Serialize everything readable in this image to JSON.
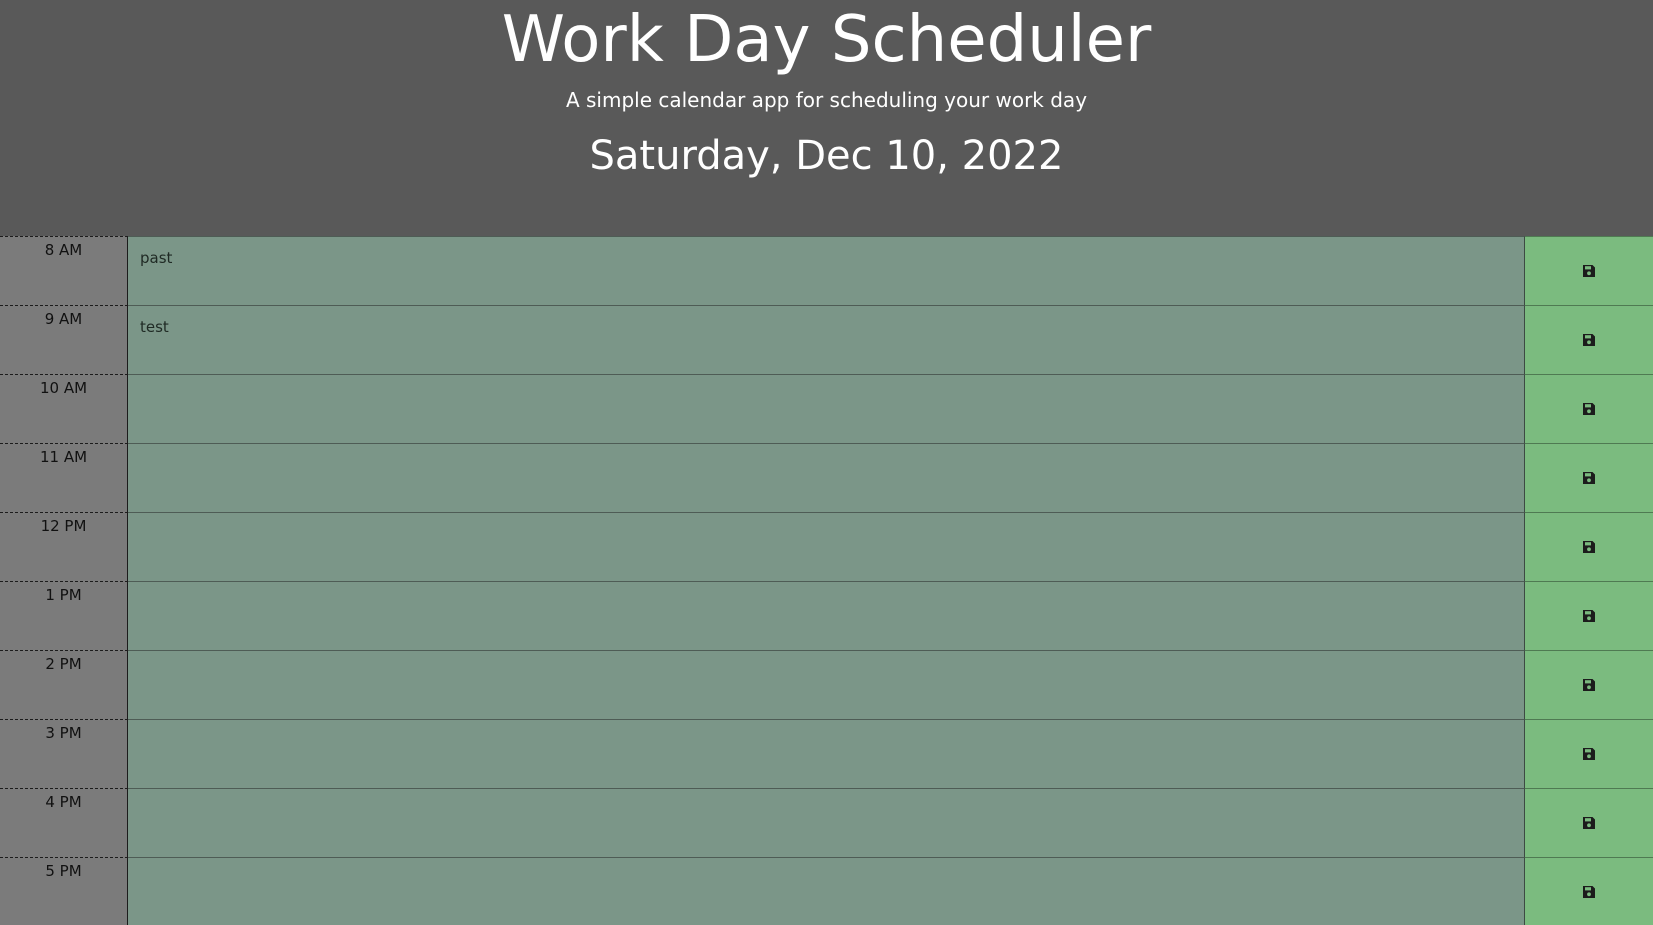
{
  "header": {
    "title": "Work Day Scheduler",
    "subtitle": "A simple calendar app for scheduling your work day",
    "current_date": "Saturday, Dec 10, 2022"
  },
  "schedule": {
    "status_colors": {
      "past": "#7b9688",
      "save_button": "#7bbb7f",
      "hour_label": "#7b7b7b"
    },
    "save_icon": "floppy-disk-icon",
    "rows": [
      {
        "hour": "8 AM",
        "text": "past"
      },
      {
        "hour": "9 AM",
        "text": "test"
      },
      {
        "hour": "10 AM",
        "text": ""
      },
      {
        "hour": "11 AM",
        "text": ""
      },
      {
        "hour": "12 PM",
        "text": ""
      },
      {
        "hour": "1 PM",
        "text": ""
      },
      {
        "hour": "2 PM",
        "text": ""
      },
      {
        "hour": "3 PM",
        "text": ""
      },
      {
        "hour": "4 PM",
        "text": ""
      },
      {
        "hour": "5 PM",
        "text": ""
      }
    ]
  }
}
